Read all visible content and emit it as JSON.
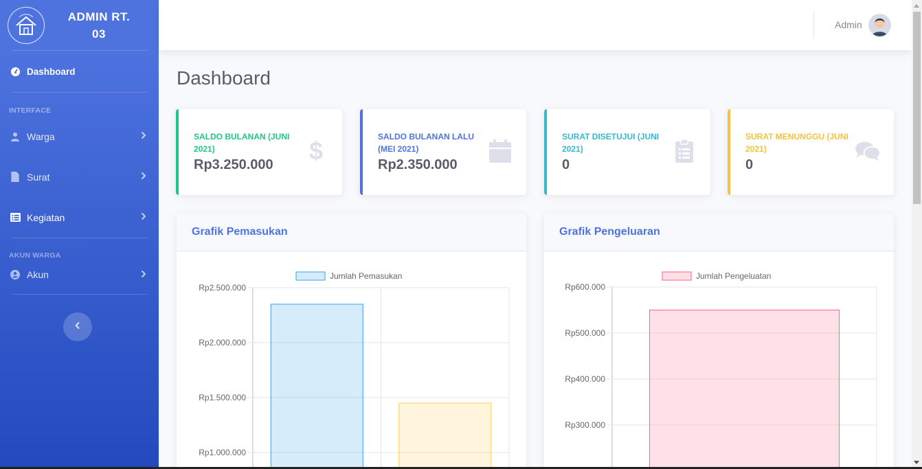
{
  "sidebar": {
    "brand_line1": "ADMIN RT.",
    "brand_line2": "03",
    "logo_icon": "house-icon",
    "dashboard_label": "Dashboard",
    "heading_interface": "INTERFACE",
    "items_interface": [
      {
        "label": "Warga",
        "icon": "user-icon"
      },
      {
        "label": "Surat",
        "icon": "file-icon"
      },
      {
        "label": "Kegiatan",
        "icon": "list-alt-icon"
      }
    ],
    "heading_akun": "AKUN WARGA",
    "items_akun": [
      {
        "label": "Akun",
        "icon": "user-circle-icon"
      }
    ],
    "toggle_icon": "chevron-left-icon"
  },
  "topbar": {
    "user_name": "Admin"
  },
  "page": {
    "title": "Dashboard"
  },
  "cards": [
    {
      "label": "SALDO BULANAN (JUNI 2021)",
      "value": "Rp3.250.000",
      "color": "#1cc88a",
      "icon": "dollar-icon"
    },
    {
      "label": "SALDO BULANAN LALU (MEI 2021)",
      "value": "Rp2.350.000",
      "color": "#4e73df",
      "icon": "calendar-icon"
    },
    {
      "label": "SURAT DISETUJUI (JUNI 2021)",
      "value": "0",
      "color": "#36b9cc",
      "icon": "clipboard-list-icon"
    },
    {
      "label": "SURAT MENUNGGU (JUNI 2021)",
      "value": "0",
      "color": "#f6c23e",
      "icon": "comments-icon"
    }
  ],
  "panels": {
    "income_title": "Grafik Pemasukan",
    "expense_title": "Grafik Pengeluaran"
  },
  "chart_data": [
    {
      "type": "bar",
      "title": "",
      "legend": "Jumlah Pemasukan",
      "legend_position": "top",
      "y_tick_labels": [
        "Rp2.500.000",
        "Rp2.000.000",
        "Rp1.500.000",
        "Rp1.000.000"
      ],
      "y_ticks": [
        2500000,
        2000000,
        1500000,
        1000000
      ],
      "ylim": [
        1000000,
        2500000
      ],
      "grid": true,
      "series": [
        {
          "name": "Jumlah Pemasukan",
          "values": [
            2350000,
            1450000
          ]
        }
      ],
      "bar_colors": [
        {
          "fill": "rgba(54,162,235,0.2)",
          "stroke": "rgba(54,162,235,1)"
        },
        {
          "fill": "rgba(255,206,86,0.2)",
          "stroke": "rgba(255,206,86,1)"
        }
      ],
      "legend_fill": "rgba(54,162,235,0.2)",
      "legend_stroke": "rgba(54,162,235,1)"
    },
    {
      "type": "bar",
      "title": "",
      "legend": "Jumlah Pengeluatan",
      "legend_position": "top",
      "y_tick_labels": [
        "Rp600.000",
        "Rp500.000",
        "Rp400.000",
        "Rp300.000"
      ],
      "y_ticks": [
        600000,
        500000,
        400000,
        300000
      ],
      "ylim": [
        300000,
        600000
      ],
      "grid": true,
      "series": [
        {
          "name": "Jumlah Pengeluatan",
          "values": [
            550000
          ]
        }
      ],
      "bar_colors": [
        {
          "fill": "rgba(255,99,132,0.2)",
          "stroke": "rgba(255,99,132,1)"
        }
      ],
      "legend_fill": "rgba(255,99,132,0.2)",
      "legend_stroke": "rgba(255,99,132,1)"
    }
  ]
}
